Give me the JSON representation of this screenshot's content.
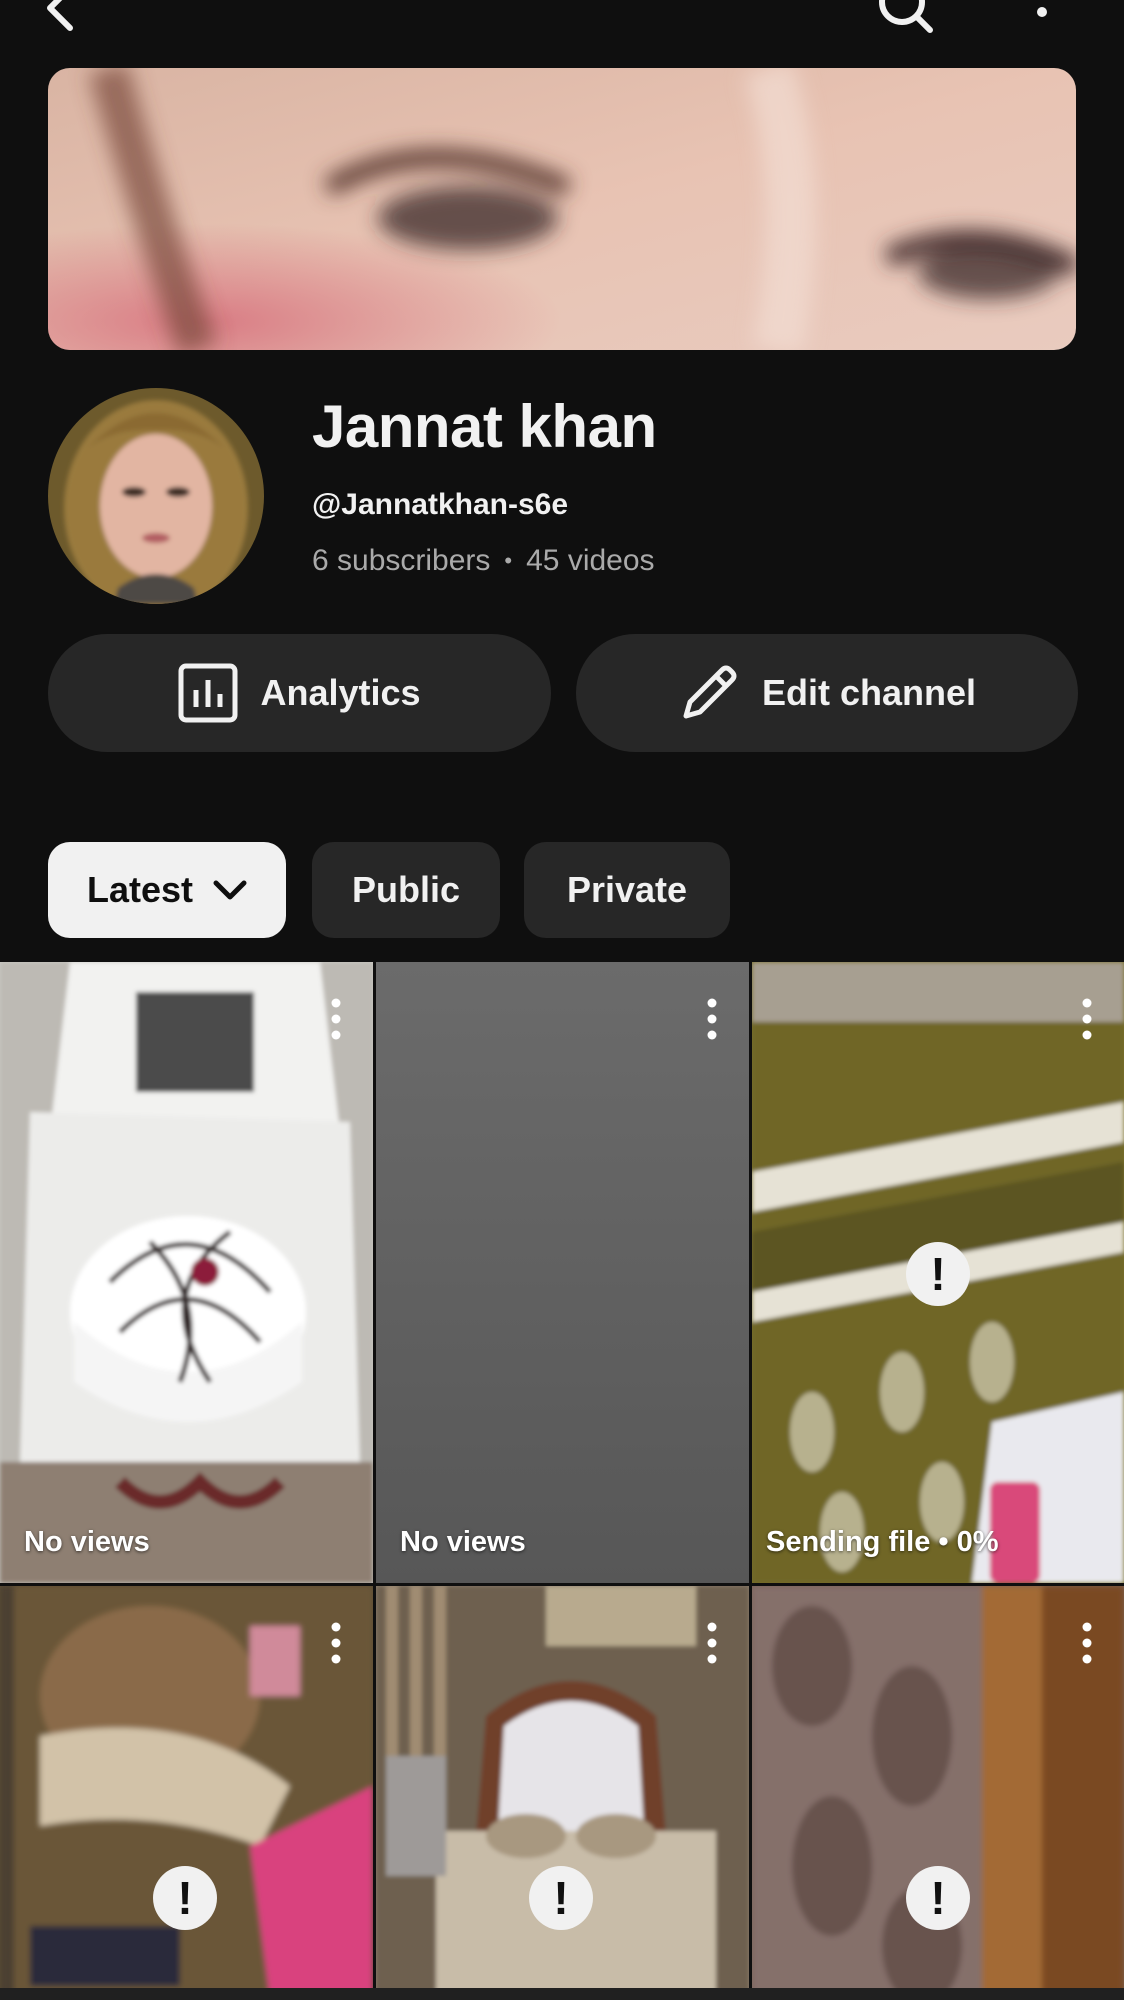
{
  "topbar": {
    "back_icon": "back-arrow-icon",
    "search_icon": "search-icon",
    "more_icon": "more-vert-icon"
  },
  "channel": {
    "name": "Jannat khan",
    "handle": "@Jannatkhan-s6e",
    "subscribers": "6 subscribers",
    "separator": "•",
    "videos": "45 videos"
  },
  "actions": {
    "analytics_label": "Analytics",
    "edit_label": "Edit channel"
  },
  "filters": {
    "sort_label": "Latest",
    "public_label": "Public",
    "private_label": "Private"
  },
  "videos": [
    {
      "status": "No views"
    },
    {
      "status": "No views"
    },
    {
      "status": "Sending file • 0%"
    },
    {
      "status": "!"
    },
    {
      "status": "!"
    },
    {
      "status": "!"
    }
  ],
  "colors": {
    "background": "#0f0f0f",
    "button_bg": "#272727",
    "chip_selected": "#f1f1f1",
    "text_secondary": "#aaaaaa"
  }
}
